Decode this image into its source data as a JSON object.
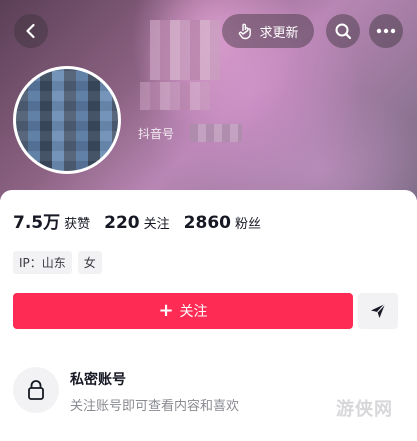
{
  "header": {
    "update_label": "求更新",
    "douyin_id_label": "抖音号"
  },
  "stats": {
    "likes": {
      "value": "7.5万",
      "label": "获赞"
    },
    "following": {
      "value": "220",
      "label": "关注"
    },
    "followers": {
      "value": "2860",
      "label": "粉丝"
    }
  },
  "tags": [
    "IP：山东",
    "女"
  ],
  "actions": {
    "follow_label": "关注"
  },
  "private_account": {
    "title": "私密账号",
    "description": "关注账号即可查看内容和喜欢"
  },
  "watermark": "游侠网",
  "colors": {
    "follow_button": "#fe2c55",
    "text_primary": "#161823",
    "text_secondary": "#8a8b91",
    "tag_bg": "#f2f2f4"
  },
  "icons": {
    "back": "chevron-left-icon",
    "update": "hand-pointer-icon",
    "search": "search-icon",
    "more": "more-dots-icon",
    "share": "send-icon",
    "lock": "lock-icon"
  }
}
